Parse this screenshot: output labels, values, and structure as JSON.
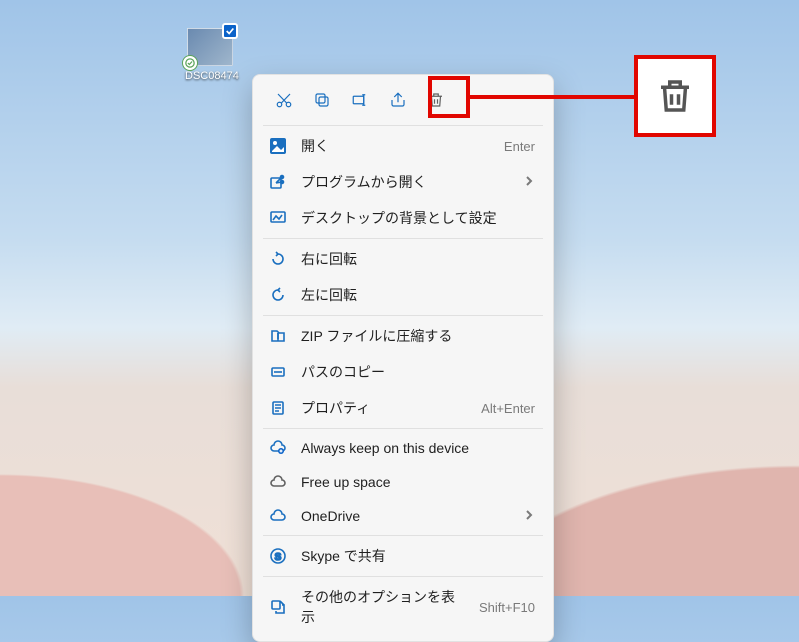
{
  "desktop": {
    "file_label": "DSC08474"
  },
  "toolbar": {
    "cut": "cut",
    "copy": "copy",
    "rename": "rename",
    "share": "share",
    "delete": "delete"
  },
  "menu": {
    "open": {
      "label": "開く",
      "shortcut": "Enter"
    },
    "open_with": {
      "label": "プログラムから開く"
    },
    "set_background": {
      "label": "デスクトップの背景として設定"
    },
    "rotate_right": {
      "label": "右に回転"
    },
    "rotate_left": {
      "label": "左に回転"
    },
    "zip": {
      "label": "ZIP ファイルに圧縮する"
    },
    "copy_path": {
      "label": "パスのコピー"
    },
    "properties": {
      "label": "プロパティ",
      "shortcut": "Alt+Enter"
    },
    "always_keep": {
      "label": "Always keep on this device"
    },
    "free_up": {
      "label": "Free up space"
    },
    "onedrive": {
      "label": "OneDrive"
    },
    "skype_share": {
      "label": "Skype で共有"
    },
    "more_options": {
      "label": "その他のオプションを表示",
      "shortcut": "Shift+F10"
    }
  }
}
